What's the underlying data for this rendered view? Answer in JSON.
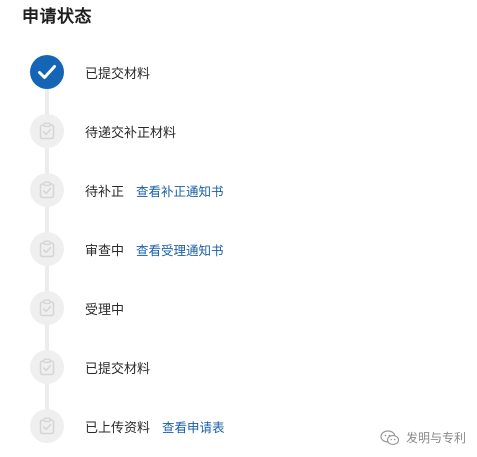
{
  "header": {
    "title": "申请状态"
  },
  "steps": [
    {
      "label": "已提交材料",
      "link": "",
      "status": "completed"
    },
    {
      "label": "待递交补正材料",
      "link": "",
      "status": "pending"
    },
    {
      "label": "待补正",
      "link": "查看补正通知书",
      "status": "pending"
    },
    {
      "label": "审查中",
      "link": "查看受理通知书",
      "status": "pending"
    },
    {
      "label": "受理中",
      "link": "",
      "status": "pending"
    },
    {
      "label": "已提交材料",
      "link": "",
      "status": "pending"
    },
    {
      "label": "已上传资料",
      "link": "查看申请表",
      "status": "pending"
    }
  ],
  "watermark": {
    "text": "发明与专利",
    "icon": "wechat-icon"
  },
  "colors": {
    "completed": "#1565b7",
    "pending": "#efefef",
    "link": "#1a5fa8",
    "connector": "#ececec"
  }
}
